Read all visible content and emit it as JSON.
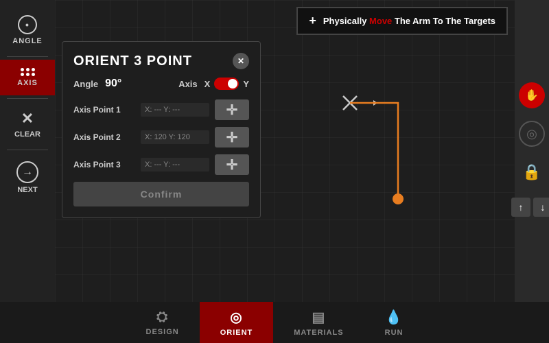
{
  "topBar": {
    "plusIcon": "+",
    "text1": "Physically ",
    "moveText": "Move",
    "text2": " The Arm To The Targets"
  },
  "sidebar": {
    "angleLabel": "ANGLE",
    "axisLabel": "AXIS",
    "clearLabel": "CLEAR",
    "nextLabel": "NEXT"
  },
  "dialog": {
    "title": "ORIENT 3 POINT",
    "angleLabel": "Angle",
    "angleValue": "90°",
    "axisLabel": "Axis",
    "axisX": "X",
    "axisY": "Y",
    "points": [
      {
        "label": "Axis Point 1",
        "value": "X: --- Y: ---"
      },
      {
        "label": "Axis Point 2",
        "value": "X: 120 Y: 120"
      },
      {
        "label": "Axis Point 3",
        "value": "X: --- Y: ---"
      }
    ],
    "confirmLabel": "Confirm"
  },
  "bottomNav": {
    "items": [
      {
        "id": "design",
        "label": "DESIGN",
        "icon": "⛭"
      },
      {
        "id": "orient",
        "label": "ORIENT",
        "icon": "◎",
        "active": true
      },
      {
        "id": "materials",
        "label": "MATERIALS",
        "icon": "▤"
      },
      {
        "id": "run",
        "label": "RUN",
        "icon": "💧"
      }
    ]
  },
  "rightSidebar": {
    "stopIcon": "✋",
    "targetIcon": "◎",
    "lockIcon": "🔒",
    "upArrow": "↑",
    "downArrow": "↓"
  }
}
